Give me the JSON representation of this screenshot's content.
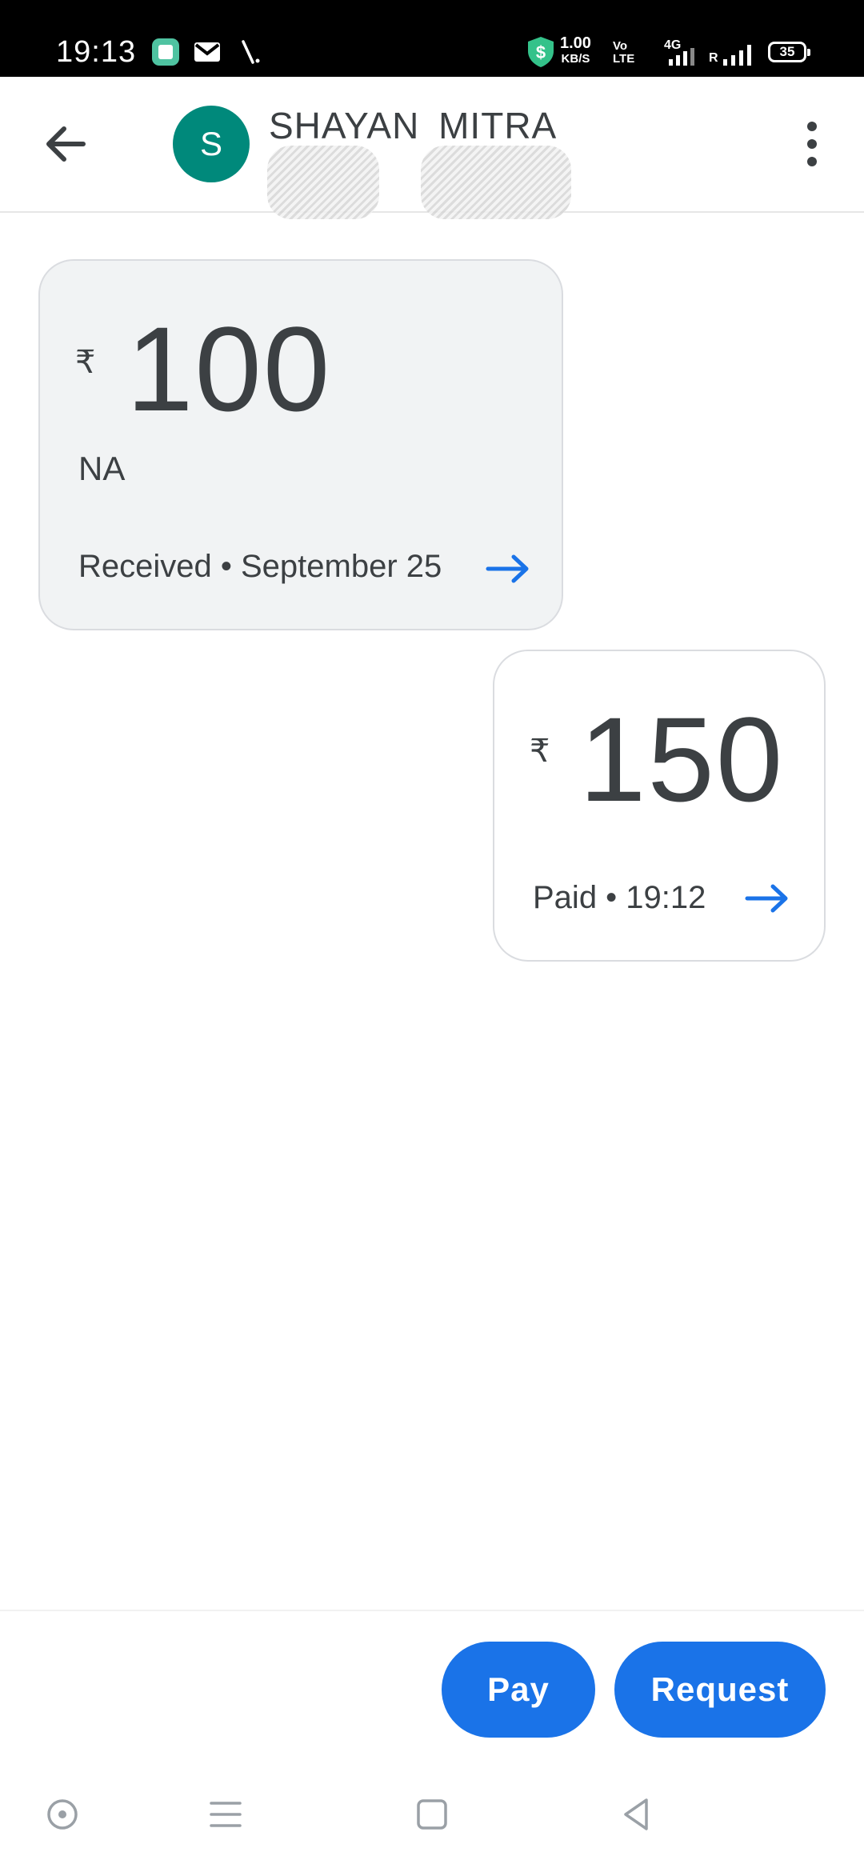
{
  "status_bar": {
    "time": "19:13",
    "net_speed_value": "1.00",
    "net_speed_unit": "KB/S",
    "volte_top": "Vo",
    "volte_bottom": "LTE",
    "network_type": "4G",
    "roaming": "R",
    "battery": "35",
    "icons": [
      "gallery-app-icon",
      "gmail-icon",
      "stylus-icon",
      "vpn-shield-icon",
      "signal-icon",
      "battery-icon"
    ]
  },
  "app_bar": {
    "avatar_letter": "S",
    "contact_name": "SHAYAN MITRA",
    "avatar_color": "#00897b",
    "icons": [
      "back-arrow-icon",
      "more-vert-icon"
    ]
  },
  "transactions": [
    {
      "currency": "₹",
      "amount": "100",
      "note": "NA",
      "status": "Received • September 25"
    },
    {
      "currency": "₹",
      "amount": "150",
      "status": "Paid • 19:12"
    }
  ],
  "actions": {
    "pay_label": "Pay",
    "request_label": "Request",
    "accent_color": "#1a73e8"
  },
  "nav_bar": {
    "icons": [
      "assistant-dot-icon",
      "recents-menu-icon",
      "home-square-icon",
      "back-triangle-icon"
    ]
  }
}
